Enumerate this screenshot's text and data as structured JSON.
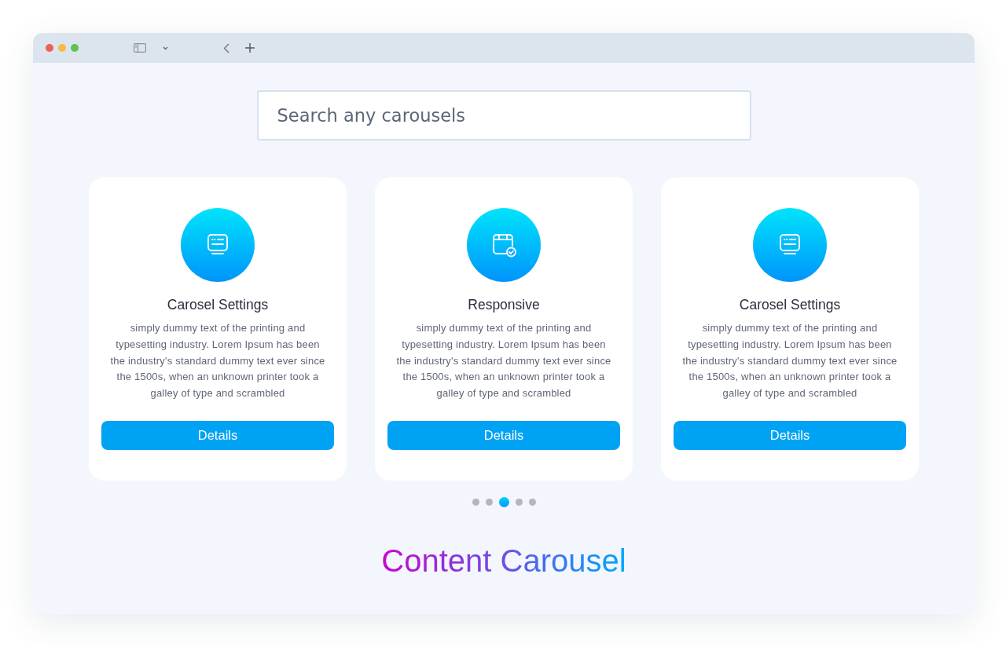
{
  "search": {
    "placeholder": "Search any carousels"
  },
  "cards": [
    {
      "kind": "screen",
      "title": "Carosel Settings",
      "description": "simply dummy text of the printing and typesetting industry. Lorem Ipsum has been the industry's standard dummy text ever since the 1500s, when an unknown printer took a galley of type and scrambled",
      "button": "Details"
    },
    {
      "kind": "calendar",
      "title": "Responsive",
      "description": "simply dummy text of the printing and typesetting industry. Lorem Ipsum has been the industry's standard dummy text ever since the 1500s, when an unknown printer took a galley of type and scrambled",
      "button": "Details"
    },
    {
      "kind": "screen",
      "title": "Carosel Settings",
      "description": "simply dummy text of the printing and typesetting industry. Lorem Ipsum has been the industry's standard dummy text ever since the 1500s, when an unknown printer took a galley of type and scrambled",
      "button": "Details"
    }
  ],
  "pagination": [
    {
      "selected": false
    },
    {
      "selected": false
    },
    {
      "selected": true
    },
    {
      "selected": false
    },
    {
      "selected": false
    }
  ],
  "heading": "Content Carousel"
}
